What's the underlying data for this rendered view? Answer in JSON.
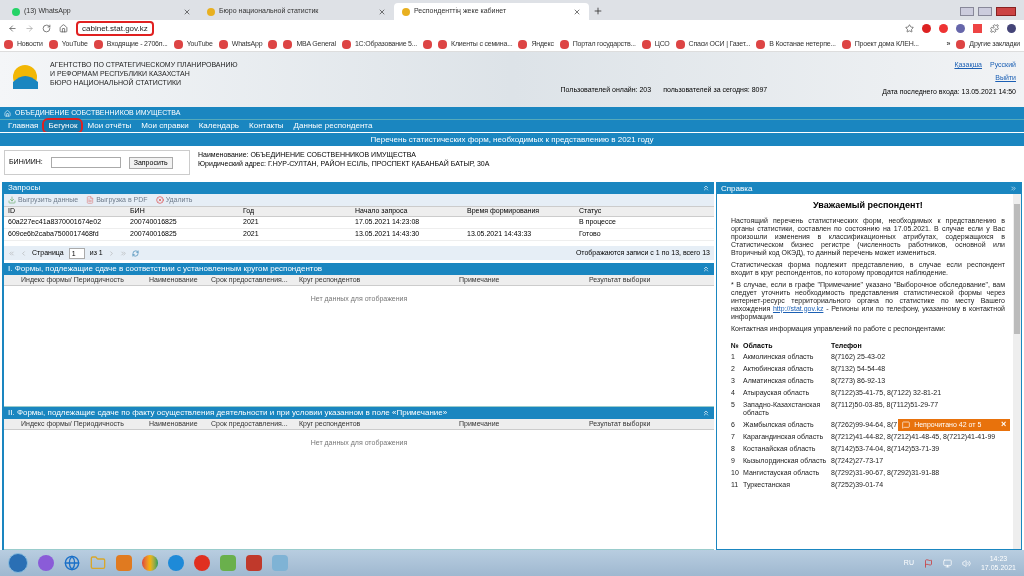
{
  "browser": {
    "tabs": [
      {
        "title": "(13) WhatsApp",
        "selected": false
      },
      {
        "title": "Бюро национальной статистик",
        "selected": false
      },
      {
        "title": "Респонденттің жеке кабинет",
        "selected": true
      }
    ],
    "address": {
      "value": "cabinet.stat.gov.kz",
      "highlighted": true
    },
    "bookmarks": [
      {
        "kind": "link",
        "label": "Новости"
      },
      {
        "kind": "link",
        "label": "YouTube"
      },
      {
        "kind": "link",
        "label": "Входящие - 2706п..."
      },
      {
        "kind": "link",
        "label": "YouTube"
      },
      {
        "kind": "link",
        "label": "WhatsApp"
      },
      {
        "kind": "icon"
      },
      {
        "kind": "link",
        "label": "MBA General"
      },
      {
        "kind": "link",
        "label": "1С:Образование 5..."
      },
      {
        "kind": "icon"
      },
      {
        "kind": "link",
        "label": "Клиенты с семина..."
      },
      {
        "kind": "link",
        "label": "Яндекс"
      },
      {
        "kind": "link",
        "label": "Портал государств..."
      },
      {
        "kind": "link",
        "label": "ЦСО"
      },
      {
        "kind": "link",
        "label": "Спаси ОСИ | Газет..."
      },
      {
        "kind": "link",
        "label": "В Костанае нетерпе..."
      },
      {
        "kind": "link",
        "label": "Проект дома КЛЕН..."
      }
    ],
    "bookmarks_more": "»",
    "other_bookmarks": "Другие закладки"
  },
  "header": {
    "agency_lines": [
      "АГЕНТСТВО ПО СТРАТЕГИЧЕСКОМУ ПЛАНИРОВАНИЮ",
      "И РЕФОРМАМ РЕСПУБЛИКИ КАЗАХСТАН",
      "БЮРО НАЦИОНАЛЬНОЙ СТАТИСТИКИ"
    ],
    "online": "Пользователей онлайн: 203",
    "today": "пользователей за сегодня: 8097",
    "languages": [
      {
        "label": "Қазақша",
        "selected": false
      },
      {
        "label": "Русский",
        "selected": true
      }
    ],
    "logout": "Выйти",
    "last_login": "Дата последнего входа: 13.05.2021 14:50"
  },
  "org_bar": "ОБЪЕДИНЕНИЕ СОБСТВЕННИКОВ ИМУЩЕСТВА",
  "nav": [
    {
      "label": "Главная",
      "highlighted": false
    },
    {
      "label": "Бегунок",
      "highlighted": true
    },
    {
      "label": "Мои отчёты",
      "highlighted": false
    },
    {
      "label": "Мои справки",
      "highlighted": false
    },
    {
      "label": "Календарь",
      "highlighted": false
    },
    {
      "label": "Контакты",
      "highlighted": false
    },
    {
      "label": "Данные респондента",
      "highlighted": false
    }
  ],
  "page_title": "Перечень статистических форм, необходимых к представлению в 2021 году",
  "query": {
    "label": "БИН/ИИН:",
    "button": "Запросить",
    "name": "Наименование: ОБЪЕДИНЕНИЕ СОБСТВЕННИКОВ ИМУЩЕСТВА",
    "address": "Юридический адрес: Г.НУР-СУЛТАН, РАЙОН ЕСІЛЬ, ПРОСПЕКТ ҚАБАНБАЙ БАТЫР, 30А"
  },
  "requests": {
    "title": "Запросы",
    "toolbar": [
      {
        "label": "Выгрузить данные",
        "kind": "download",
        "disabled": true
      },
      {
        "label": "Выгрузка в PDF",
        "kind": "pdf",
        "disabled": true
      },
      {
        "label": "Удалить",
        "kind": "delete",
        "disabled": true
      }
    ],
    "columns": [
      "ID",
      "БИН",
      "Год",
      "Начало запроса",
      "Время формирования",
      "Статус"
    ],
    "rows": [
      [
        "60a227ec41a8370001674e02",
        "200740016825",
        "2021",
        "17.05.2021 14:23:08",
        "",
        "В процессе"
      ],
      [
        "609ce6b2caba7500017468fd",
        "200740016825",
        "2021",
        "13.05.2021 14:43:30",
        "13.05.2021 14:43:33",
        "Готово"
      ]
    ],
    "pager": {
      "page_label": "Страница",
      "page": "1",
      "of": "из 1",
      "summary": "Отображаются записи с 1 по 13, всего 13"
    }
  },
  "sections": [
    {
      "title": "I. Формы, подлежащие сдаче в соответствии с установленным кругом респондентов",
      "columns": [
        "Индекс формы/ Периодичность",
        "Наименование",
        "Срок предоставления...",
        "Круг респондентов",
        "Примечание",
        "Результат выборки"
      ],
      "empty": "Нет данных для отображения"
    },
    {
      "title": "II. Формы, подлежащие сдаче по факту осуществления деятельности и при условии указанном в поле «Примечание»",
      "columns": [
        "Индекс формы/ Периодичность",
        "Наименование",
        "Срок предоставления...",
        "Круг респондентов",
        "Примечание",
        "Результат выборки"
      ],
      "empty": "Нет данных для отображения"
    }
  ],
  "help": {
    "title": "Справка",
    "heading": "Уважаемый респондент!",
    "paragraphs": [
      {
        "text": "Настоящий перечень статистических форм, необходимых к представлению в органы статистики, составлен по состоянию на 17.05.2021. В случае если у Вас произошли изменения в классификационных атрибутах, содержащихся в Статистическом бизнес регистре (численность работников, основной или Вторичный код ОКЭД), то данный перечень может измениться."
      },
      {
        "text": "Статистическая форма подлежит представлению, в случае если респондент входит в круг респондентов, по которому проводится наблюдение."
      },
      {
        "text": "* В случае, если в графе \"Примечание\" указано \"Выборочное обследование\", вам следует уточнить необходимость представления статистической формы через интернет-ресурс территориального органа по статистике по месту Вашего нахождения",
        "link": "http://stat.gov.kz",
        "after": " - Регионы или по телефону, указанному в контактной информации"
      },
      {
        "text": "Контактная информация управлений по работе с респондентами:"
      }
    ],
    "table_head": [
      "№",
      "Область",
      "Телефон"
    ],
    "contacts": [
      [
        "1",
        "Акмолинская область",
        "8(7162) 25-43-02"
      ],
      [
        "2",
        "Актюбинская область",
        "8(7132) 54-54-48"
      ],
      [
        "3",
        "Алматинская область",
        "8(7273) 86-92-13"
      ],
      [
        "4",
        "Атырауская область",
        "8(7122)35-41-75, 8(7122) 32-81-21"
      ],
      [
        "5",
        "Западно-Казахстанская область",
        "8(7112)50-03-85, 8(7112)51-29-77"
      ],
      [
        "6",
        "Жамбылская область",
        "8(7262)99-94-64, 8(7"
      ],
      [
        "7",
        "Карагандинская область",
        "8(7212)41-44-82, 8(7212)41-48-45, 8(7212)41-41-99"
      ],
      [
        "8",
        "Костанайская область",
        "8(7142)53-74-04, 8(7142)53-71-39"
      ],
      [
        "9",
        "Кызылординская область",
        "8(7242)27-73-17"
      ],
      [
        "10",
        "Мангистауская область",
        "8(7292)31-90-67, 8(7292)31-91-88"
      ],
      [
        "11",
        "Туркестанская",
        "8(7252)39-01-74"
      ]
    ]
  },
  "toast": {
    "text": "Непрочитано 42 от 5",
    "close": "×"
  },
  "taskbar": {
    "language": "RU",
    "time": "14:23",
    "date": "17.05.2021"
  }
}
